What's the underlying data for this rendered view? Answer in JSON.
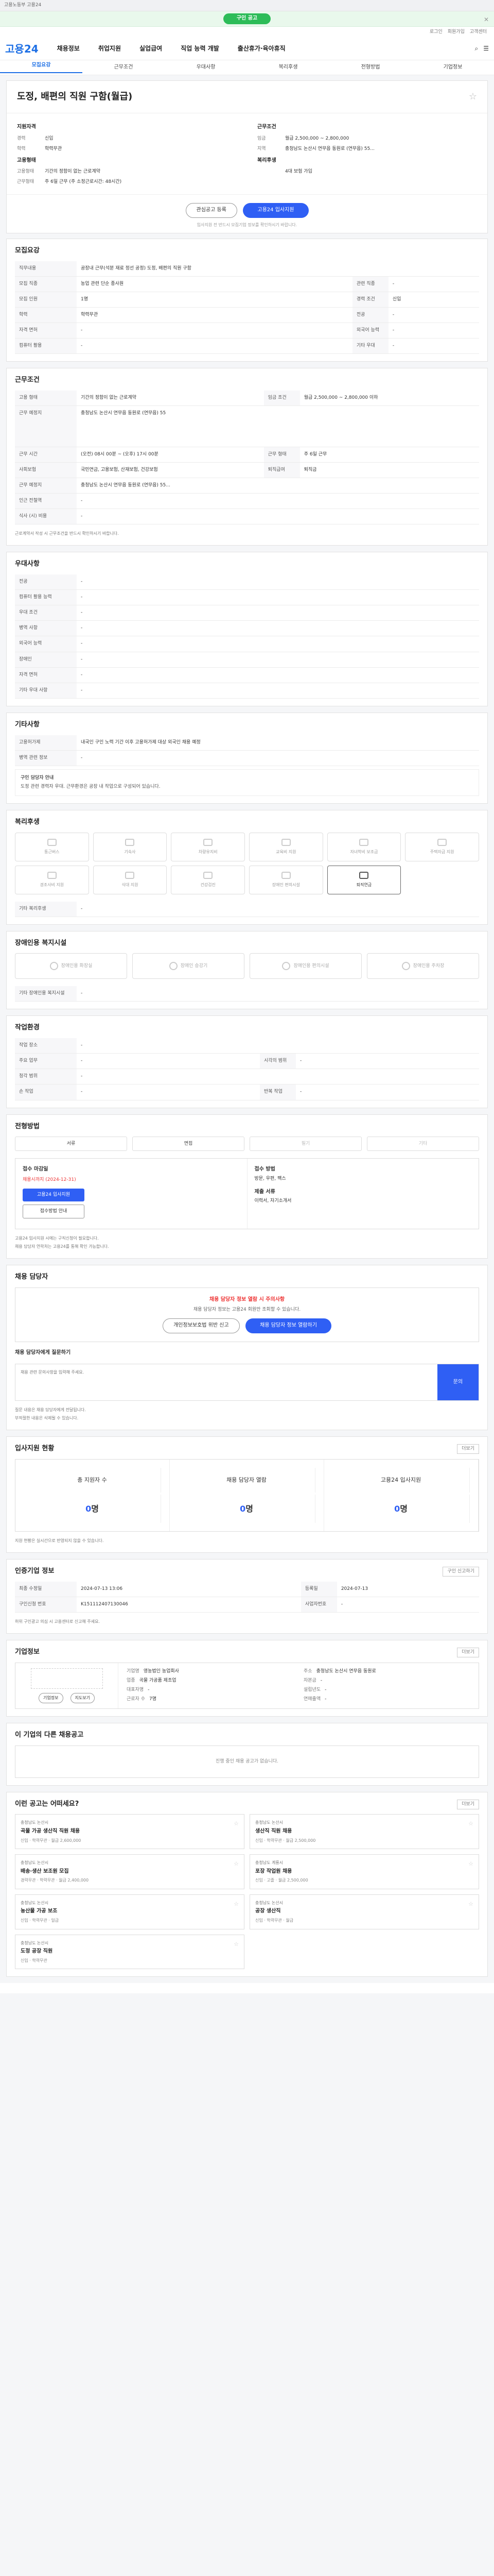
{
  "promo": {
    "text": "구인 공고"
  },
  "util": [
    "로그인",
    "회원가입",
    "고객센터"
  ],
  "header": {
    "logo_a": "고용",
    "logo_b": "24",
    "menu": [
      "채용정보",
      "취업지원",
      "실업급여",
      "직업 능력 개발",
      "출산휴가·육아휴직"
    ]
  },
  "tabs": [
    "모집요강",
    "근무조건",
    "우대사항",
    "복리후생",
    "전형방법",
    "기업정보"
  ],
  "job": {
    "title": "도정, 배편의 직원 구함(월급)",
    "company": "",
    "left_head": "지원자격",
    "left": [
      [
        "경력",
        "신입"
      ],
      [
        "학력",
        "학력무관"
      ]
    ],
    "left_head2": "고용형태",
    "left2": [
      [
        "고용형태",
        "기간의 정함이 없는 근로계약"
      ],
      [
        "근무형태",
        "주 6일 근무 (주 소정근로시간: 48시간)"
      ]
    ],
    "right_head": "근무조건",
    "right": [
      [
        "임금",
        "월급 2,500,000 ~ 2,800,000"
      ],
      [
        "지역",
        "충청남도 논산시 연무읍 동원로 (연무읍) 55..."
      ]
    ],
    "right_head2": "복리후생",
    "right2": [
      [
        "",
        "4대 보험 가입"
      ]
    ],
    "btn_fav": "관심공고 등록",
    "btn_apply": "고용24 입사지원",
    "apply_note": "입사지원 전 반드시 모집기업 정보를 확인하시기 바랍니다."
  },
  "recruit": {
    "title": "모집요강",
    "desc_label": "직무내용",
    "desc": "공장내 근무(석분 재료 정선 공정) 도정, 배편의 직원 구함",
    "rows": [
      [
        "모집 직종",
        "농업 관련 단순 종사원",
        "관련 직종",
        "-"
      ],
      [
        "모집 인원",
        "1명",
        "경력 조건",
        "신입"
      ],
      [
        "학력",
        "학력무관",
        "전공",
        "-"
      ],
      [
        "자격 면허",
        "-",
        "외국어 능력",
        "-"
      ],
      [
        "컴퓨터 활용",
        "-",
        "기타 우대",
        "-"
      ]
    ]
  },
  "work": {
    "title": "근무조건",
    "rows": [
      [
        "고용 형태",
        "기간의 정함이 없는 근로계약",
        "임금 조건",
        "월급 2,500,000 ~ 2,800,000 이하"
      ],
      [
        "근무 예정지",
        "충청남도 논산시 연무읍 동원로 (연무읍) 55",
        "",
        ""
      ],
      [
        "근무 시간",
        "(오전) 08시 00분 ~ (오후) 17시 00분",
        "근무 형태",
        "주 6일 근무"
      ],
      [
        "사회보험",
        "국민연금, 고용보험, 산재보험, 건강보험",
        "퇴직급여",
        "퇴직금"
      ],
      [
        "근무 예정지",
        "충청남도 논산시 연무읍 동원로 (연무읍) 55...",
        "",
        ""
      ],
      [
        "인근 전철역",
        "-",
        "",
        ""
      ],
      [
        "식사 (시) 비용",
        "-",
        "",
        ""
      ]
    ],
    "note": "근로계약서 작성 시 근무조건을 반드시 확인하시기 바랍니다."
  },
  "pref": {
    "title": "우대사항",
    "rows": [
      [
        "전공",
        "-"
      ],
      [
        "컴퓨터 활용 능력",
        "-"
      ],
      [
        "우대 조건",
        "-"
      ],
      [
        "병역 사항",
        "-"
      ],
      [
        "외국어 능력",
        "-"
      ],
      [
        "장애인",
        "-"
      ],
      [
        "자격 면허",
        "-"
      ],
      [
        "기타 우대 사항",
        "-"
      ]
    ]
  },
  "other": {
    "title": "기타사항",
    "rows": [
      [
        "고용허가제",
        "내국인 구인 노력 기간 이후 고용허가제 대상 외국인 채용 예정"
      ],
      [
        "병역 관련 정보",
        "-"
      ]
    ],
    "box_title": "구인 담당자 안내",
    "box_text": "도정 관련 경력자 우대. 근무환경은 공장 내 작업으로 구성되어 있습니다."
  },
  "welfare": {
    "title": "복리후생",
    "items": [
      "통근버스",
      "기숙사",
      "차량유지비",
      "교육비 지원",
      "자녀학비 보조금",
      "주택자금 지원",
      "경조사비 지원",
      "식대 지원",
      "건강검진",
      "장애인 편의시설",
      "퇴직연금"
    ],
    "etc_label": "기타 복리후생",
    "etc": "-"
  },
  "disabled": {
    "title": "장애인용 복지시설",
    "items": [
      "장애인용 화장실",
      "장애인 승강기",
      "장애인용 편의시설",
      "장애인용 주차장"
    ],
    "etc_label": "기타 장애인용 복지시설",
    "etc": "-"
  },
  "env": {
    "title": "작업환경",
    "rows": [
      [
        "작업 장소",
        "-",
        "",
        ""
      ],
      [
        "주요 업무",
        "-",
        "시각의 범위",
        "-"
      ],
      [
        "청각 범위",
        "-",
        "",
        ""
      ],
      [
        "손 작업",
        "-",
        "반복 작업",
        "-"
      ]
    ]
  },
  "method": {
    "title": "전형방법",
    "btns": [
      "서류",
      "면접",
      "필기",
      "기타"
    ],
    "deadline_label": "접수 마감일",
    "deadline": "채용시까지 (2024-12-31)",
    "btn_apply": "고용24 입사지원",
    "btn_apply2": "접수방법 안내",
    "way_label": "접수 방법",
    "way": "방문, 우편, 팩스",
    "docs_label": "제출 서류",
    "docs": "이력서, 자기소개서",
    "notes": [
      "고용24 입사지원 시에는 구직신청이 필요합니다.",
      "채용 담당자 연락처는 고용24를 통해 확인 가능합니다."
    ]
  },
  "contact": {
    "title": "채용 담당자",
    "warn": "채용 담당자 정보 열람 시 주의사항",
    "sub": "채용 담당자 정보는 고용24 회원만 조회할 수 있습니다.",
    "btn1": "개인정보보호법 위반 신고",
    "btn2": "채용 담당자 정보 열람하기",
    "ask_title": "채용 담당자에게 질문하기",
    "ask_placeholder": "채용 관련 문의사항을 입력해 주세요.",
    "ask_btn": "문의",
    "notes": [
      "질문 내용은 채용 담당자에게 전달됩니다.",
      "부적절한 내용은 삭제될 수 있습니다."
    ]
  },
  "stats": {
    "title": "입사지원 현황",
    "more": "더보기",
    "items": [
      [
        "총 지원자 수",
        "0",
        "명"
      ],
      [
        "채용 담당자 열람",
        "0",
        "명"
      ],
      [
        "고용24 입사지원",
        "0",
        "명"
      ]
    ],
    "note": "지원 현황은 실시간으로 반영되지 않을 수 있습니다."
  },
  "posting": {
    "title": "인증기업 정보",
    "btn": "구인 신고하기",
    "rows": [
      [
        "최종 수정일",
        "2024-07-13 13:06",
        "등록일",
        "2024-07-13"
      ],
      [
        "구인신청 번호",
        "K151112407130046",
        "사업자번호",
        "-"
      ]
    ],
    "note": "허위 구인광고 의심 시 고용센터로 신고해 주세요."
  },
  "company": {
    "title": "기업정보",
    "more": "더보기",
    "b1": "기업정보",
    "b2": "지도보기",
    "info": [
      [
        "기업명",
        "영농법인 농업회사"
      ],
      [
        "업종",
        "곡물 가공품 제조업"
      ],
      [
        "대표자명",
        "-"
      ],
      [
        "근로자 수",
        "7명"
      ],
      [
        "주소",
        "충청남도 논산시 연무읍 동원로"
      ],
      [
        "자본금",
        "-"
      ],
      [
        "설립년도",
        "-"
      ],
      [
        "연매출액",
        "-"
      ]
    ]
  },
  "others": {
    "title": "이 기업의 다른 채용공고",
    "empty": "진행 중인 채용 공고가 없습니다."
  },
  "recommend": {
    "title": "이런 공고는 어떠세요?",
    "more": "더보기",
    "items": [
      {
        "c": "충청남도 논산시",
        "t": "곡물 가공 생산직 직원 채용",
        "d": "신입 · 학력무관 · 월급 2,600,000"
      },
      {
        "c": "충청남도 논산시",
        "t": "생산직 직원 채용",
        "d": "신입 · 학력무관 · 월급 2,500,000"
      },
      {
        "c": "충청남도 논산시",
        "t": "배송·생산 보조원 모집",
        "d": "경력무관 · 학력무관 · 월급 2,400,000"
      },
      {
        "c": "충청남도 계룡시",
        "t": "포장 작업원 채용",
        "d": "신입 · 고졸 · 월급 2,500,000"
      },
      {
        "c": "충청남도 논산시",
        "t": "농산물 가공 보조",
        "d": "신입 · 학력무관 · 일급"
      },
      {
        "c": "충청남도 논산시",
        "t": "공장 생산직",
        "d": "신입 · 학력무관 · 월급"
      },
      {
        "c": "충청남도 논산시",
        "t": "도정 공장 직원",
        "d": "신입 · 학력무관"
      },
      {
        "c": "",
        "t": "",
        "d": ""
      }
    ]
  }
}
